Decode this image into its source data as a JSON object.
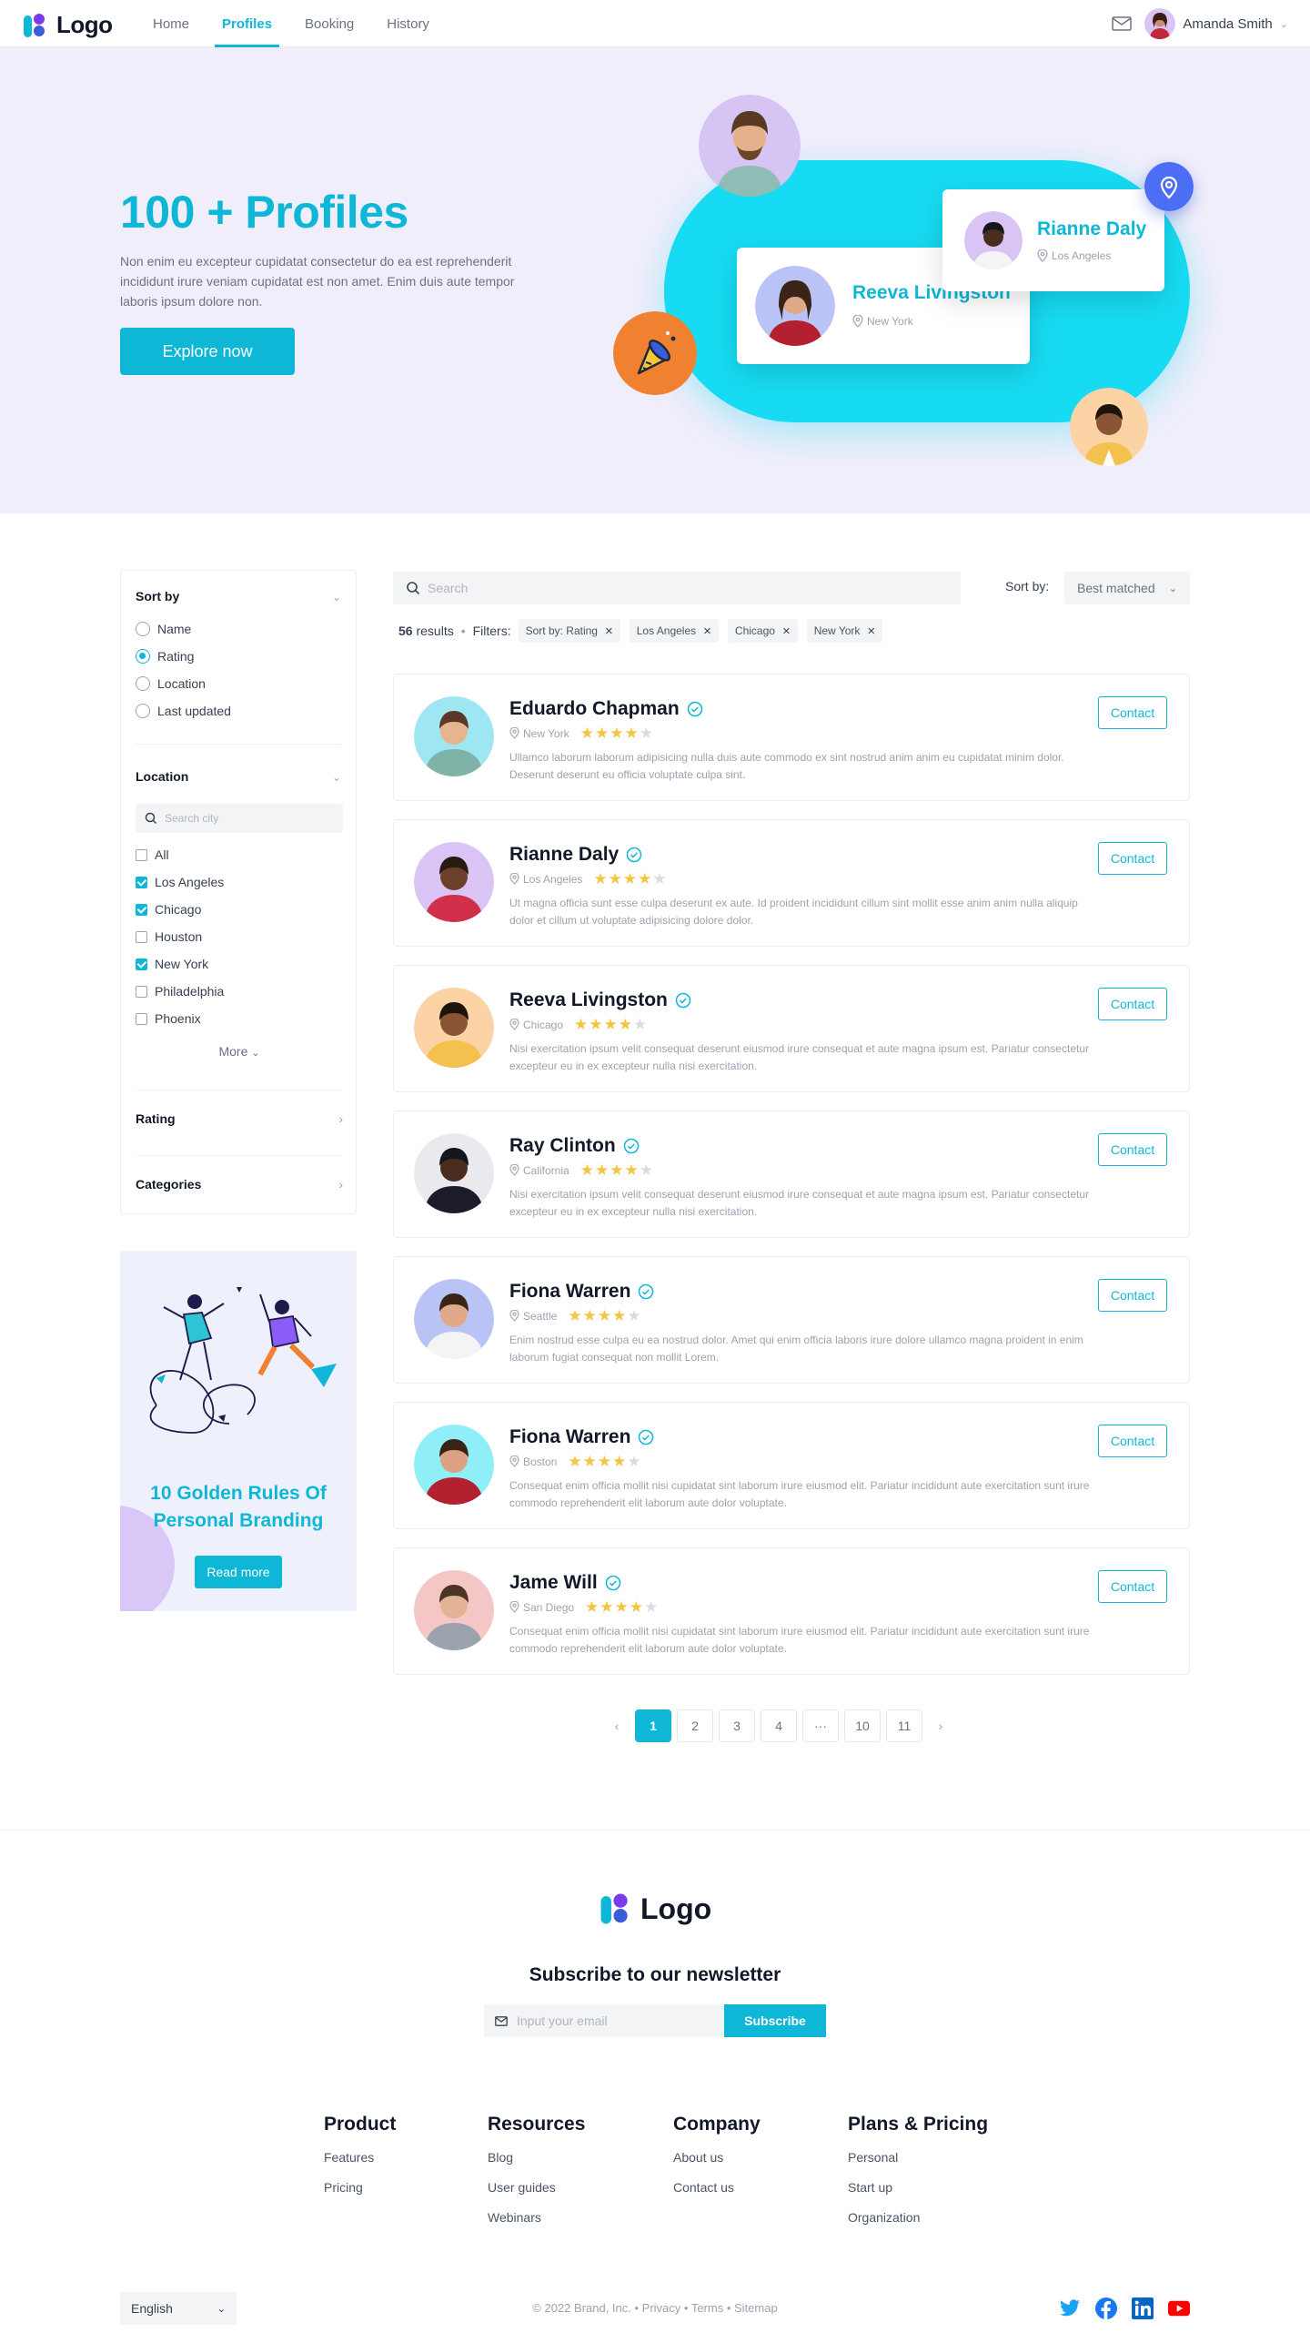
{
  "header": {
    "logo_text": "Logo",
    "nav": [
      "Home",
      "Profiles",
      "Booking",
      "History"
    ],
    "active_nav": "Profiles",
    "user_name": "Amanda Smith"
  },
  "hero": {
    "title": "100 + Profiles",
    "text": "Non enim eu excepteur cupidatat consectetur do ea est reprehenderit incididunt irure veniam cupidatat est non amet. Enim duis aute tempor laboris ipsum dolore non.",
    "cta": "Explore now",
    "card1": {
      "name": "Reeva Livingston",
      "location": "New York"
    },
    "card2": {
      "name": "Rianne Daly",
      "location": "Los Angeles"
    }
  },
  "sidebar": {
    "sort_title": "Sort by",
    "sort_options": [
      "Name",
      "Rating",
      "Location",
      "Last updated"
    ],
    "sort_selected": "Rating",
    "location_title": "Location",
    "city_placeholder": "Search city",
    "cities": [
      {
        "label": "All",
        "checked": false
      },
      {
        "label": "Los Angeles",
        "checked": true
      },
      {
        "label": "Chicago",
        "checked": true
      },
      {
        "label": "Houston",
        "checked": false
      },
      {
        "label": "New York",
        "checked": true
      },
      {
        "label": "Philadelphia",
        "checked": false
      },
      {
        "label": "Phoenix",
        "checked": false
      }
    ],
    "more": "More",
    "rating_title": "Rating",
    "categories_title": "Categories"
  },
  "promo": {
    "title_line1": "10 Golden Rules Of",
    "title_line2": "Personal Branding",
    "button": "Read more"
  },
  "results": {
    "search_placeholder": "Search",
    "sort_label": "Sort by:",
    "sort_value": "Best matched",
    "count": "56",
    "count_suffix": "results",
    "filters_label": "Filters:",
    "chips": [
      "Sort by: Rating",
      "Los Angeles",
      "Chicago",
      "New York"
    ],
    "contact_label": "Contact",
    "profiles": [
      {
        "name": "Eduardo Chapman",
        "location": "New York",
        "rating": 4,
        "desc": "Ullamco laborum laborum adipisicing nulla duis aute commodo ex sint nostrud anim anim eu cupidatat minim dolor. Deserunt deserunt eu officia voluptate culpa sint.",
        "avatar_bg": "#9ee7f2",
        "skin": "#e6b48e",
        "hair": "#5a3a26",
        "shirt": "#7fb3a8"
      },
      {
        "name": "Rianne Daly",
        "location": "Los Angeles",
        "rating": 4,
        "desc": "Ut magna officia sunt esse culpa deserunt ex aute. Id proident incididunt cillum sint mollit esse anim anim nulla aliquip dolor et cillum ut voluptate adipisicing dolore dolor.",
        "avatar_bg": "#d9c4f5",
        "skin": "#6b3f2a",
        "hair": "#2a1a12",
        "shirt": "#d0304a"
      },
      {
        "name": "Reeva Livingston",
        "location": "Chicago",
        "rating": 4,
        "desc": "Nisi exercitation ipsum velit consequat deserunt eiusmod irure consequat et aute magna ipsum est. Pariatur consectetur excepteur eu in ex excepteur nulla nisi exercitation.",
        "avatar_bg": "#fbd3a5",
        "skin": "#8a5534",
        "hair": "#1f140d",
        "shirt": "#f2c14e"
      },
      {
        "name": "Ray Clinton",
        "location": "California",
        "rating": 4,
        "desc": "Nisi exercitation ipsum velit consequat deserunt eiusmod irure consequat et aute magna ipsum est. Pariatur consectetur excepteur eu in ex excepteur nulla nisi exercitation.",
        "avatar_bg": "#e8eaee",
        "skin": "#4a2c1d",
        "hair": "#15151e",
        "shirt": "#1c1c2b"
      },
      {
        "name": "Fiona Warren",
        "location": "Seattle",
        "rating": 4,
        "desc": "Enim nostrud esse culpa eu ea nostrud dolor. Amet qui enim officia laboris irure dolore ullamco magna proident in enim laborum fugiat consequat non mollit Lorem.",
        "avatar_bg": "#b9c3f5",
        "skin": "#e0a98a",
        "hair": "#3a2418",
        "shirt": "#f4f4f4"
      },
      {
        "name": "Fiona Warren",
        "location": "Boston",
        "rating": 4,
        "desc": "Consequat enim officia mollit nisi cupidatat sint laborum irure eiusmod elit. Pariatur incididunt aute exercitation sunt irure commodo reprehenderit elit laborum aute dolor voluptate.",
        "avatar_bg": "#8feef7",
        "skin": "#dca083",
        "hair": "#3b2318",
        "shirt": "#b3202f"
      },
      {
        "name": "Jame Will",
        "location": "San Diego",
        "rating": 4,
        "desc": "Consequat enim officia mollit nisi cupidatat sint laborum irure eiusmod elit. Pariatur incididunt aute exercitation sunt irure commodo reprehenderit elit laborum aute dolor voluptate.",
        "avatar_bg": "#f5c6c6",
        "skin": "#e2b394",
        "hair": "#4b3426",
        "shirt": "#9aa3ad"
      }
    ]
  },
  "pagination": {
    "pages": [
      "1",
      "2",
      "3",
      "4",
      "···",
      "10",
      "11"
    ],
    "current": "1"
  },
  "footer": {
    "logo_text": "Logo",
    "newsletter_title": "Subscribe to our newsletter",
    "email_placeholder": "Input your email",
    "subscribe": "Subscribe",
    "columns": [
      {
        "title": "Product",
        "links": [
          "Features",
          "Pricing"
        ]
      },
      {
        "title": "Resources",
        "links": [
          "Blog",
          "User guides",
          "Webinars"
        ]
      },
      {
        "title": "Company",
        "links": [
          "About us",
          "Contact us"
        ]
      },
      {
        "title": "Plans & Pricing",
        "links": [
          "Personal",
          "Start up",
          "Organization"
        ]
      }
    ],
    "language": "English",
    "copyright": "© 2022 Brand, Inc. • Privacy • Terms • Sitemap"
  },
  "colors": {
    "accent": "#0fb7d6",
    "hero_bg": "#f1eefb",
    "blob": "#17dbf2",
    "star": "#f3c63f"
  }
}
